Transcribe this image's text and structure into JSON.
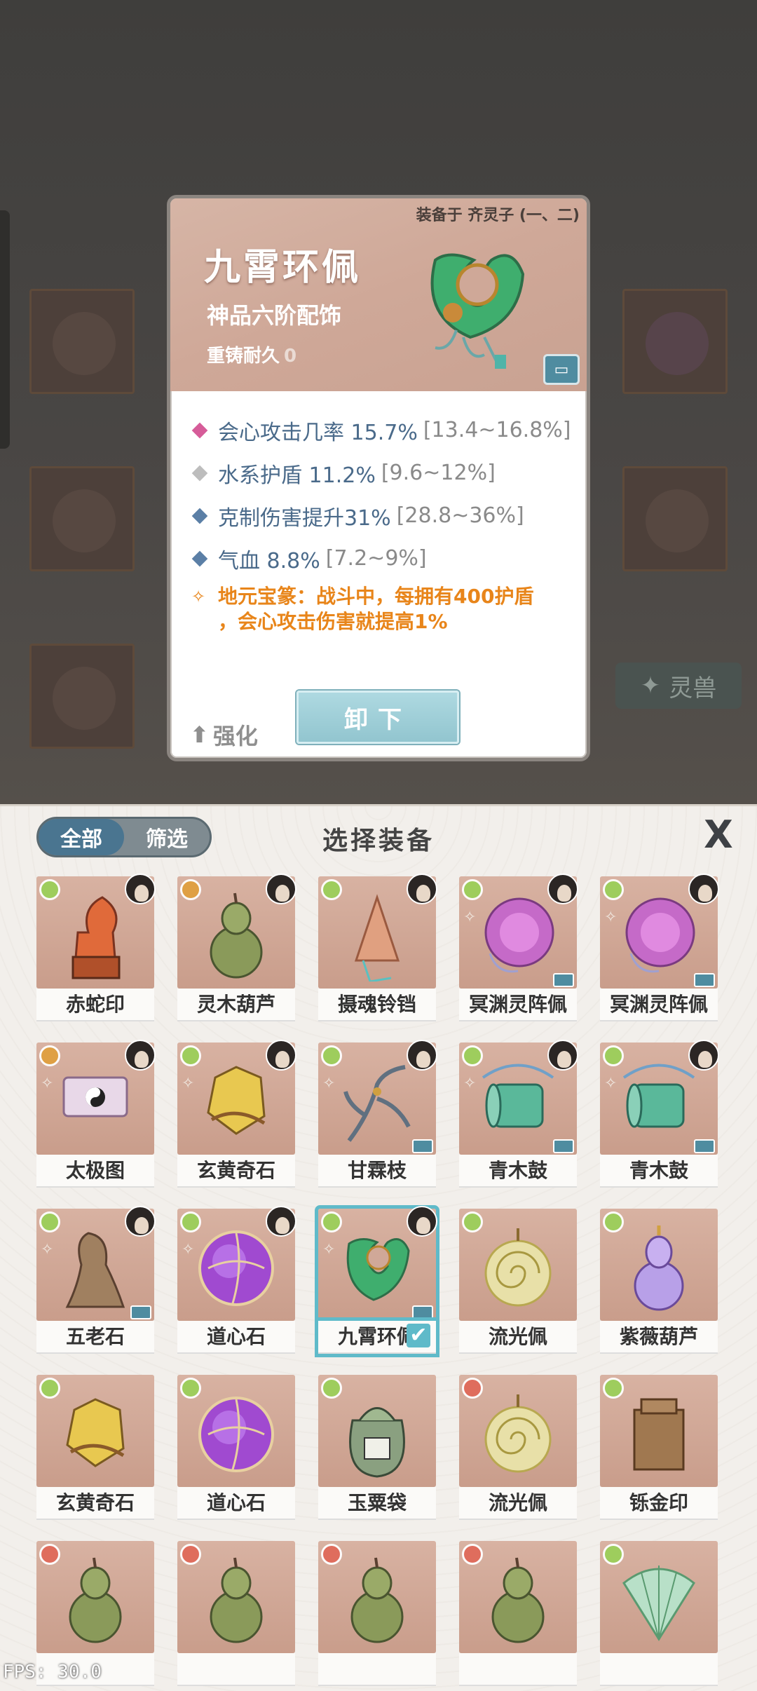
{
  "tooltip": {
    "equipped_on": "装备于 齐灵子 (一、二)",
    "name": "九霄环佩",
    "grade": "神品六阶配饰",
    "durability_label": "重铸耐久",
    "durability_value": "0",
    "stats": [
      {
        "name": "会心攻击几率 15.7%",
        "range": "[13.4~16.8%]",
        "color": "#d65c99"
      },
      {
        "name": "水系护盾 11.2%",
        "range": "[9.6~12%]",
        "color": "#bdbdbd"
      },
      {
        "name": "克制伤害提升31%",
        "range": "[28.8~36%]",
        "color": "#5b7fa6"
      },
      {
        "name": "气血 8.8%",
        "range": "[7.2~9%]",
        "color": "#5b7fa6"
      }
    ],
    "special_line1": "地元宝篆：战斗中，每拥有400护盾",
    "special_line2": "，会心攻击伤害就提高1%",
    "upgrade_label": "强化",
    "unequip_label": "卸下"
  },
  "background": {
    "tab_label": "灵兽"
  },
  "panel": {
    "filter_all": "全部",
    "filter_screen": "筛选",
    "title": "选择装备",
    "close_label": "X"
  },
  "items": [
    {
      "label": "赤蛇印",
      "gem": "#9ccf5a",
      "avatar": true,
      "sig": false,
      "lock": false,
      "art": "seal-orange"
    },
    {
      "label": "灵木葫芦",
      "gem": "#e0a040",
      "avatar": true,
      "sig": false,
      "lock": false,
      "art": "gourd"
    },
    {
      "label": "摄魂铃铛",
      "gem": "#9ccf5a",
      "avatar": true,
      "sig": false,
      "lock": false,
      "art": "bell"
    },
    {
      "label": "冥渊灵阵佩",
      "gem": "#9ccf5a",
      "avatar": true,
      "sig": true,
      "lock": true,
      "art": "purple-disc"
    },
    {
      "label": "冥渊灵阵佩",
      "gem": "#9ccf5a",
      "avatar": true,
      "sig": true,
      "lock": true,
      "art": "purple-disc"
    },
    {
      "label": "太极图",
      "gem": "#e0a040",
      "avatar": true,
      "sig": true,
      "lock": false,
      "art": "scroll"
    },
    {
      "label": "玄黄奇石",
      "gem": "#9ccf5a",
      "avatar": true,
      "sig": true,
      "lock": false,
      "art": "gold-rock"
    },
    {
      "label": "甘霖枝",
      "gem": "#9ccf5a",
      "avatar": true,
      "sig": true,
      "lock": true,
      "art": "branch"
    },
    {
      "label": "青木鼓",
      "gem": "#9ccf5a",
      "avatar": true,
      "sig": true,
      "lock": true,
      "art": "drum"
    },
    {
      "label": "青木鼓",
      "gem": "#9ccf5a",
      "avatar": true,
      "sig": true,
      "lock": true,
      "art": "drum"
    },
    {
      "label": "五老石",
      "gem": "#9ccf5a",
      "avatar": true,
      "sig": true,
      "lock": true,
      "art": "stone"
    },
    {
      "label": "道心石",
      "gem": "#9ccf5a",
      "avatar": true,
      "sig": true,
      "lock": false,
      "art": "purple-orb"
    },
    {
      "label": "九霄环佩",
      "gem": "#9ccf5a",
      "avatar": true,
      "sig": true,
      "lock": true,
      "art": "jade-ring",
      "selected": true
    },
    {
      "label": "流光佩",
      "gem": "#9ccf5a",
      "avatar": false,
      "sig": false,
      "lock": false,
      "art": "pendant"
    },
    {
      "label": "紫薇葫芦",
      "gem": "#9ccf5a",
      "avatar": false,
      "sig": false,
      "lock": false,
      "art": "purple-gourd"
    },
    {
      "label": "玄黄奇石",
      "gem": "#9ccf5a",
      "avatar": false,
      "sig": false,
      "lock": false,
      "art": "gold-rock"
    },
    {
      "label": "道心石",
      "gem": "#9ccf5a",
      "avatar": false,
      "sig": false,
      "lock": false,
      "art": "purple-orb"
    },
    {
      "label": "玉粟袋",
      "gem": "#9ccf5a",
      "avatar": false,
      "sig": false,
      "lock": false,
      "art": "bag"
    },
    {
      "label": "流光佩",
      "gem": "#e06a5a",
      "avatar": false,
      "sig": false,
      "lock": false,
      "art": "pendant"
    },
    {
      "label": "铄金印",
      "gem": "#9ccf5a",
      "avatar": false,
      "sig": false,
      "lock": false,
      "art": "bronze-seal"
    },
    {
      "label": "",
      "gem": "#e06a5a",
      "avatar": false,
      "sig": false,
      "lock": false,
      "art": "gourd"
    },
    {
      "label": "",
      "gem": "#e06a5a",
      "avatar": false,
      "sig": false,
      "lock": false,
      "art": "gourd"
    },
    {
      "label": "",
      "gem": "#e06a5a",
      "avatar": false,
      "sig": false,
      "lock": false,
      "art": "gourd"
    },
    {
      "label": "",
      "gem": "#e06a5a",
      "avatar": false,
      "sig": false,
      "lock": false,
      "art": "gourd"
    },
    {
      "label": "",
      "gem": "#9ccf5a",
      "avatar": false,
      "sig": false,
      "lock": false,
      "art": "fan"
    }
  ],
  "fps_text": "FPS: 30.0"
}
